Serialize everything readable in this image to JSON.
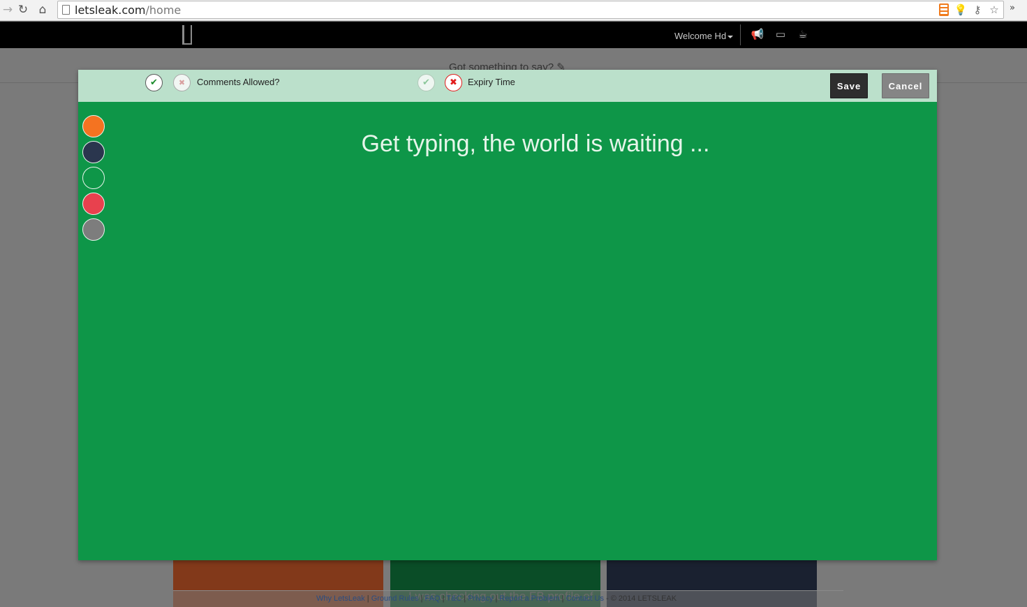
{
  "browser": {
    "url_domain": "letsleak.com",
    "url_path": "/home",
    "overflow": "»"
  },
  "topnav": {
    "welcome_label": "Welcome Hd"
  },
  "page": {
    "prompt": "Got something to say?",
    "card_peek": "I was checking out the FB profile of"
  },
  "modal": {
    "comments_label": "Comments Allowed?",
    "expiry_label": "Expiry Time",
    "save_label": "Save",
    "cancel_label": "Cancel",
    "placeholder": "Get typing, the world is waiting ..."
  },
  "swatches": [
    {
      "name": "orange",
      "color": "#f47321"
    },
    {
      "name": "navy",
      "color": "#2a364e"
    },
    {
      "name": "green",
      "color": "#0e9648"
    },
    {
      "name": "red",
      "color": "#e8414e"
    },
    {
      "name": "gray",
      "color": "#7d7d7d"
    }
  ],
  "background_cards": [
    {
      "color": "#82391a"
    },
    {
      "color": "#0a4d27"
    },
    {
      "color": "#1a2130"
    }
  ],
  "footer": {
    "links": [
      "Why LetsLeak",
      "Ground Rules",
      "FAQ",
      "T&C",
      "Privacy",
      "Report a Problem",
      "Contact Us"
    ],
    "copyright": " - © 2014 LETSLEAK"
  }
}
